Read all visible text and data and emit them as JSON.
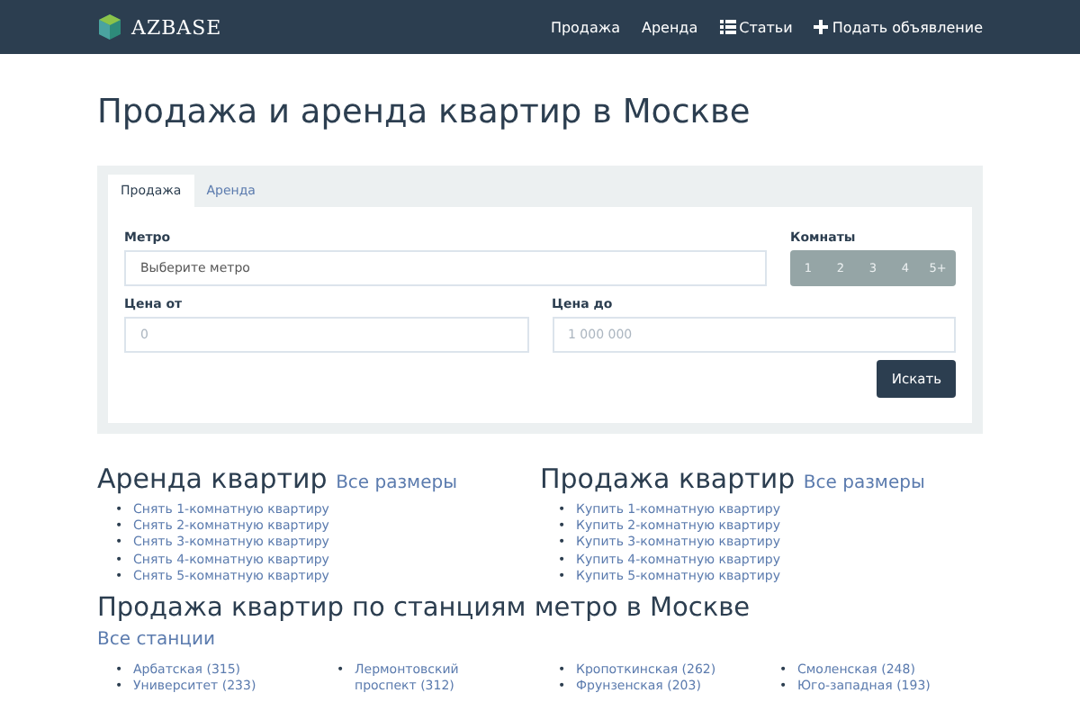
{
  "navbar": {
    "brand": "AZBASE",
    "links": [
      {
        "label": "Продажа"
      },
      {
        "label": "Аренда"
      },
      {
        "label": "Статьи"
      },
      {
        "label": "Подать объявление"
      }
    ]
  },
  "title": "Продажа и аренда квартир в Москве",
  "search": {
    "tabs": [
      {
        "label": "Продажа",
        "selected": true
      },
      {
        "label": "Аренда",
        "selected": false
      }
    ],
    "metro": {
      "label": "Метро",
      "placeholder": "Выберите метро"
    },
    "rooms": {
      "label": "Комнаты",
      "options": [
        {
          "label": "1",
          "selected": false
        },
        {
          "label": "2",
          "selected": false
        },
        {
          "label": "3",
          "selected": false
        },
        {
          "label": "4",
          "selected": false
        },
        {
          "label": "5+",
          "selected": false
        }
      ]
    },
    "price_from": {
      "label": "Цена от",
      "placeholder": "0"
    },
    "price_to": {
      "label": "Цена до",
      "placeholder": "1 000 000"
    },
    "submit": "Искать"
  },
  "sections": [
    {
      "title": "Аренда квартир",
      "more": "Все размеры",
      "bullet": "•",
      "links": [
        "Снять 1-комнатную квартиру",
        "Снять 2-комнатную квартиру",
        "Снять 3-комнатную квартиру",
        "Снять 4-комнатную квартиру",
        "Снять 5-комнатную квартиру"
      ]
    },
    {
      "title": "Продажа квартир",
      "more": "Все размеры",
      "bullet": "•",
      "links": [
        "Купить 1-комнатную квартиру",
        "Купить 2-комнатную квартиру",
        "Купить 3-комнатную квартиру",
        "Купить 4-комнатную квартиру",
        "Купить 5-комнатную квартиру"
      ]
    }
  ],
  "metro_section": {
    "title": "Продажа квартир по станциям метро в Москве",
    "more": "Все станции",
    "bullet": "•",
    "columns": [
      [
        "Арбатская (315)",
        "Университет (233)"
      ],
      [
        "Лермонтовский проспект (312)"
      ],
      [
        "Кропоткинская (262)",
        "Фрунзенская (203)"
      ],
      [
        "Смоленская (248)",
        "Юго-западная (193)"
      ]
    ]
  }
}
